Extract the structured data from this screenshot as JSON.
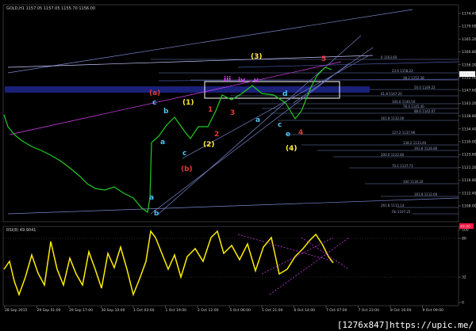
{
  "price_panel": {
    "title": "GOLD,H1 1157.05 1157.05 1155.70 1156.00",
    "y_ticks": [
      "1174.40",
      "1170.00",
      "1165.20",
      "1160.80",
      "1156.20",
      "1152.00",
      "1147.60",
      "1143.20",
      "1138.80",
      "1134.40",
      "1130.00",
      "1125.60",
      "1121.20",
      "1116.80",
      "1112.40",
      "1108.00"
    ],
    "price_tag": "1156.00",
    "fib_labels": [
      "0 1163.60",
      "23.6 1158.22",
      "38.2 1152.38",
      "50.0 1149.22",
      "61.8 1147.20",
      "100.0 1140.50",
      "76.4 1145.40",
      "88.6 1142.07",
      "161.8 1132.00",
      "127.2 1137.96",
      "138.2 1133.40",
      "161.8 1126.80",
      "200.0 1122.80",
      "70.1 1137.71",
      "100 1116.20",
      "161.8 1112.60",
      "261.8 1115.14",
      "Fib 1107.25"
    ]
  },
  "rsi_panel": {
    "title": "RSI(8) 49.9041",
    "y_ticks": [
      "100",
      "80",
      "32",
      "0"
    ],
    "value_tag": "49.90"
  },
  "x_axis": [
    "28 Sep 2015",
    "29 Sep 01:00",
    "29 Sep 17:00",
    "30 Sep 10:00",
    "1 Oct 03:00",
    "1 Oct 19:00",
    "2 Oct 12:00",
    "5 Oct 06:00",
    "5 Oct 21:00",
    "6 Oct 14:00",
    "7 Oct 07:00",
    "7 Oct 23:00",
    "8 Oct 16:00",
    "9 Oct 09:00"
  ],
  "wave_labels": [
    {
      "t": "(a)",
      "c": "#e53935"
    },
    {
      "t": "c",
      "c": "#4fc3f7"
    },
    {
      "t": "(1)",
      "c": "#ffeb3b"
    },
    {
      "t": "b",
      "c": "#4fc3f7"
    },
    {
      "t": "a",
      "c": "#4fc3f7"
    },
    {
      "t": "c",
      "c": "#4fc3f7"
    },
    {
      "t": "(2)",
      "c": "#ffeb3b"
    },
    {
      "t": "(b)",
      "c": "#e53935"
    },
    {
      "t": "a",
      "c": "#4fc3f7"
    },
    {
      "t": "b",
      "c": "#4fc3f7"
    },
    {
      "t": "(3)",
      "c": "#ffeb3b"
    },
    {
      "t": "(4)",
      "c": "#ffeb3b"
    },
    {
      "t": "d",
      "c": "#4fc3f7"
    },
    {
      "t": "e",
      "c": "#4fc3f7"
    },
    {
      "t": "a",
      "c": "#4fc3f7"
    },
    {
      "t": "c",
      "c": "#4fc3f7"
    },
    {
      "t": "1",
      "c": "#e53935"
    },
    {
      "t": "2",
      "c": "#e53935"
    },
    {
      "t": "3",
      "c": "#e53935"
    },
    {
      "t": "4",
      "c": "#e53935"
    },
    {
      "t": "5",
      "c": "#e53935"
    },
    {
      "t": "iii",
      "c": "#e040fb"
    },
    {
      "t": "iv",
      "c": "#e040fb"
    },
    {
      "t": "v",
      "c": "#e040fb"
    }
  ],
  "watermark": "[1276x847]https://upic.me/",
  "colors": {
    "bg": "#000000",
    "price_line": "#22cc22",
    "rsi_line": "#ffee00",
    "fib": "#6f7fb8",
    "band": "#1a237e",
    "trend": "#7986cb",
    "pink": "#e040fb",
    "tag": "#ff1744"
  }
}
